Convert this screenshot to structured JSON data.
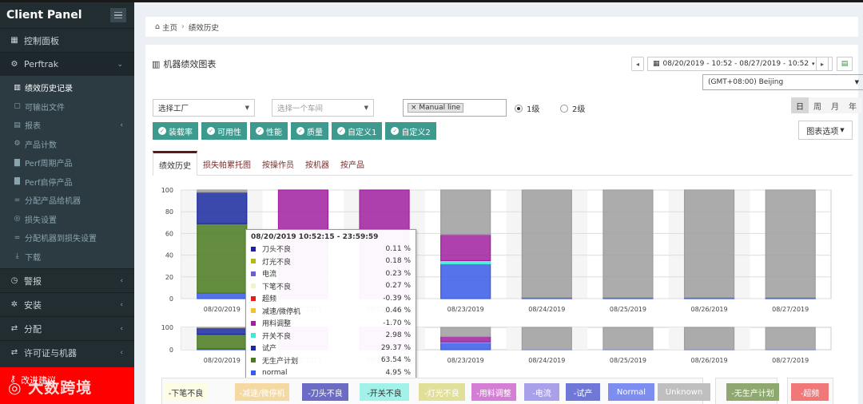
{
  "sidebar": {
    "brand": "Client Panel",
    "dashboard": "控制面板",
    "perftrak": "Perftrak",
    "sub": [
      {
        "label": "绩效历史记录",
        "icon": "chart-icon",
        "active": true
      },
      {
        "label": "可输出文件",
        "icon": "file-icon"
      },
      {
        "label": "报表",
        "icon": "report-icon",
        "chevron": true
      },
      {
        "label": "产品计数",
        "icon": "cogs-icon"
      },
      {
        "label": "Perf周期产品",
        "icon": "bars-icon"
      },
      {
        "label": "Perf启停产品",
        "icon": "bars-icon"
      },
      {
        "label": "分配产品给机器",
        "icon": "equals-icon"
      },
      {
        "label": "损失设置",
        "icon": "target-icon"
      },
      {
        "label": "分配机器到损失设置",
        "icon": "equals-icon"
      },
      {
        "label": "下载",
        "icon": "download-icon"
      }
    ],
    "alarm": "警报",
    "install": "安装",
    "assign": "分配",
    "license": "许可证与机器",
    "advice": "改进建议",
    "watermark": "大数跨境"
  },
  "breadcrumb": {
    "home": "主页",
    "current": "绩效历史"
  },
  "panel": {
    "title": "机器绩效图表",
    "date_range": "08/20/2019 - 10:52 - 08/27/2019 - 10:52",
    "timezone": "(GMT+08:00) Beijing"
  },
  "filters": {
    "factory": "选择工厂",
    "workshop": "选择一个车间",
    "tag": "Manual line",
    "level1": "1级",
    "level2": "2级",
    "periods": [
      "日",
      "周",
      "月",
      "年"
    ],
    "chart_options": "图表选项"
  },
  "metrics": [
    "装载率",
    "可用性",
    "性能",
    "质量",
    "自定义1",
    "自定义2"
  ],
  "tabs": [
    "绩效历史",
    "损失帕累托图",
    "按操作员",
    "按机器",
    "按产品"
  ],
  "tooltip": {
    "title": "08/20/2019 10:52:15 - 23:59:59",
    "rows": [
      {
        "name": "刀头不良",
        "value": "0.11 %",
        "color": "#1f1fa8"
      },
      {
        "name": "灯光不良",
        "value": "0.18 %",
        "color": "#b8b814"
      },
      {
        "name": "电流",
        "value": "0.23 %",
        "color": "#6b5fd6"
      },
      {
        "name": "下笔不良",
        "value": "0.27 %",
        "color": "#f2f2cc"
      },
      {
        "name": "超频",
        "value": "-0.39 %",
        "color": "#e81c1c"
      },
      {
        "name": "减速/微停机",
        "value": "0.46 %",
        "color": "#f5c033"
      },
      {
        "name": "用料调整",
        "value": "-1.70 %",
        "color": "#a020a0"
      },
      {
        "name": "开关不良",
        "value": "2.98 %",
        "color": "#40e8d8"
      },
      {
        "name": "试产",
        "value": "29.37 %",
        "color": "#1a2aa0"
      },
      {
        "name": "无生产计划",
        "value": "63.54 %",
        "color": "#4a7a1e"
      },
      {
        "name": "normal",
        "value": "4.95 %",
        "color": "#3a5ae8"
      }
    ]
  },
  "legend": [
    {
      "label": "-下笔不良",
      "bg": "#fdfde6",
      "fg": "#333"
    },
    {
      "label": "-减速/微停机",
      "bg": "#f5d9a3",
      "fg": "#fff"
    },
    {
      "label": "-刀头不良",
      "bg": "#6c6cc4",
      "fg": "#fff"
    },
    {
      "label": "-开关不良",
      "bg": "#a3f2ea",
      "fg": "#333"
    },
    {
      "label": "-灯光不良",
      "bg": "#e0e09a",
      "fg": "#fff"
    },
    {
      "label": "-用料调整",
      "bg": "#d47fd4",
      "fg": "#fff"
    },
    {
      "label": "-电流",
      "bg": "#a8a0e8",
      "fg": "#fff"
    },
    {
      "label": "-试产",
      "bg": "#6f78d6",
      "fg": "#fff"
    },
    {
      "label": "Normal",
      "bg": "#7d8ef0",
      "fg": "#fff"
    },
    {
      "label": "Unknown",
      "bg": "#bfbfbf",
      "fg": "#fff"
    },
    {
      "label": "-无生产计划",
      "bg": "#8fa870",
      "fg": "#fff"
    },
    {
      "label": "-超频",
      "bg": "#f07878",
      "fg": "#fff"
    }
  ],
  "chart_data": [
    {
      "type": "bar",
      "stacked": true,
      "categories": [
        "08/20/2019",
        "08/21/2019",
        "08/22/2019",
        "08/23/2019",
        "08/24/2019",
        "08/25/2019",
        "08/26/2019",
        "08/27/2019"
      ],
      "ylim": [
        0,
        100
      ],
      "yticks": [
        0,
        20,
        40,
        60,
        80,
        100
      ],
      "series": [
        {
          "name": "normal",
          "color": "#3a5ae8",
          "values": [
            5,
            0,
            0,
            32,
            1,
            1,
            1,
            1
          ]
        },
        {
          "name": "无生产计划",
          "color": "#4a7a1e",
          "values": [
            64,
            0,
            0,
            0,
            0,
            0,
            0,
            0
          ]
        },
        {
          "name": "开关不良",
          "color": "#40e8d8",
          "values": [
            0,
            0,
            0,
            3,
            0,
            0,
            0,
            0
          ]
        },
        {
          "name": "用料调整",
          "color": "#a020a0",
          "values": [
            0,
            100,
            100,
            24,
            0,
            0,
            0,
            0
          ]
        },
        {
          "name": "试产",
          "color": "#1a2aa0",
          "values": [
            29,
            0,
            0,
            0,
            0,
            0,
            0,
            0
          ]
        },
        {
          "name": "Unknown",
          "color": "#9e9e9e",
          "values": [
            2,
            0,
            0,
            41,
            99,
            99,
            99,
            99
          ]
        }
      ]
    },
    {
      "type": "bar",
      "stacked": true,
      "categories": [
        "08/20/2019",
        "08/21/2019",
        "08/22/2019",
        "08/23/2019",
        "08/24/2019",
        "08/25/2019",
        "08/26/2019",
        "08/27/2019"
      ],
      "ylim": [
        0,
        100
      ],
      "yticks": [
        0,
        100
      ],
      "series": [
        {
          "name": "normal",
          "color": "#3a5ae8",
          "values": [
            5,
            0,
            0,
            32,
            1,
            1,
            1,
            1
          ]
        },
        {
          "name": "无生产计划",
          "color": "#4a7a1e",
          "values": [
            64,
            0,
            0,
            0,
            0,
            0,
            0,
            0
          ]
        },
        {
          "name": "开关不良",
          "color": "#40e8d8",
          "values": [
            0,
            0,
            0,
            3,
            0,
            0,
            0,
            0
          ]
        },
        {
          "name": "用料调整",
          "color": "#a020a0",
          "values": [
            0,
            100,
            100,
            24,
            0,
            0,
            0,
            0
          ]
        },
        {
          "name": "试产",
          "color": "#1a2aa0",
          "values": [
            29,
            0,
            0,
            0,
            0,
            0,
            0,
            0
          ]
        },
        {
          "name": "Unknown",
          "color": "#9e9e9e",
          "values": [
            2,
            0,
            0,
            41,
            99,
            99,
            99,
            99
          ]
        }
      ]
    }
  ]
}
